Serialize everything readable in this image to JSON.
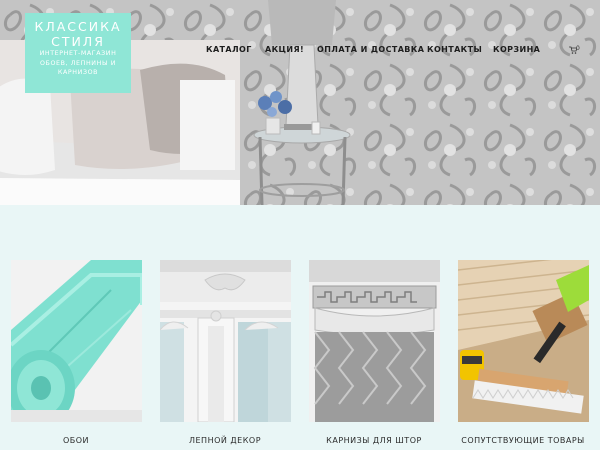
{
  "logo": {
    "title_line1": "КЛАССИКА",
    "title_line2": "СТИЛЯ",
    "sub_line1": "ИНТЕРНЕТ-МАГАЗИН",
    "sub_line2": "ОБОЕВ, ЛЕПНИНЫ И",
    "sub_line3": "КАРНИЗОВ"
  },
  "nav": {
    "items": [
      {
        "label": "КАТАЛОГ"
      },
      {
        "label": "АКЦИЯ!"
      },
      {
        "label": "ОПЛАТА И ДОСТАВКА"
      },
      {
        "label": "КОНТАКТЫ"
      },
      {
        "label": "КОРЗИНА"
      }
    ]
  },
  "cart": {
    "count": "0",
    "icon": "cart-icon"
  },
  "categories": [
    {
      "label": "ОБОИ"
    },
    {
      "label": "ЛЕПНОЙ ДЕКОР"
    },
    {
      "label": "КАРНИЗЫ ДЛЯ ШТОР"
    },
    {
      "label": "СОПУТСТВУЮЩИЕ ТОВАРЫ"
    }
  ],
  "colors": {
    "accent": "#8fe6d6",
    "page_bg": "#e9f6f6",
    "text": "#1d1d1d"
  }
}
